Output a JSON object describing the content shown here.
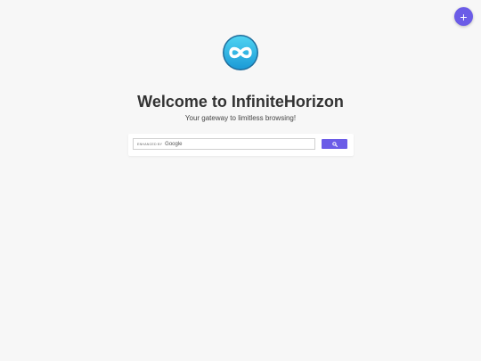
{
  "fab": {
    "label": "+",
    "icon": "plus-icon"
  },
  "logo": {
    "icon": "infinity-icon"
  },
  "header": {
    "title": "Welcome to InfiniteHorizon",
    "subtitle": "Your gateway to limitless browsing!"
  },
  "search": {
    "enhanced_label": "ENHANCED BY",
    "brand": "Google",
    "value": "",
    "button_icon": "search-icon"
  },
  "colors": {
    "background": "#f7f7f7",
    "accent": "#6b5ce7",
    "logo_gradient_top": "#3ec9ef",
    "logo_gradient_bottom": "#1c9bd6"
  }
}
